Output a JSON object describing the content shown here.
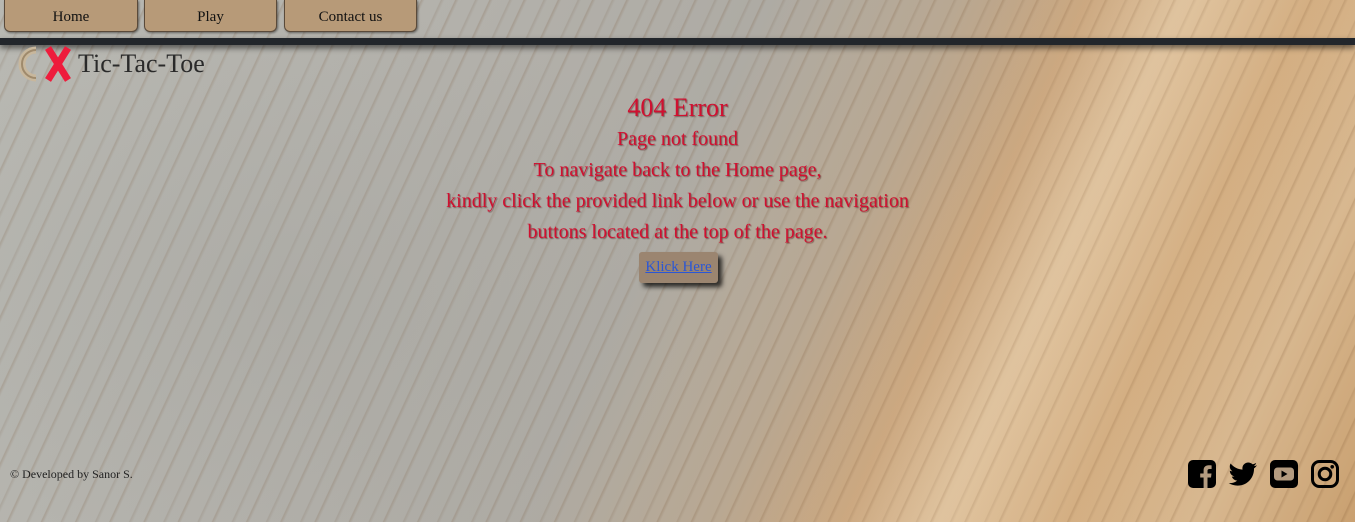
{
  "nav": {
    "items": [
      {
        "label": "Home"
      },
      {
        "label": "Play"
      },
      {
        "label": "Contact us"
      }
    ]
  },
  "brand": {
    "title": "Tic-Tac-Toe",
    "logo_icon": "o-x-logo-icon"
  },
  "error": {
    "title": "404 Error",
    "subtitle": "Page not found",
    "lines": [
      "To navigate back to the Home page,",
      "kindly click the provided link below or use the navigation",
      "buttons located at the top of the page."
    ],
    "link_label": "Klick Here"
  },
  "footer": {
    "credit": "© Developed by Sanor S.",
    "social_icons": [
      "facebook-icon",
      "twitter-icon",
      "youtube-icon",
      "instagram-icon"
    ]
  },
  "colors": {
    "nav_button": "#b79a78",
    "nav_bar": "#22262b",
    "error_text": "#d01030",
    "link": "#2a56d6",
    "logo_x": "#ee1c3c"
  }
}
